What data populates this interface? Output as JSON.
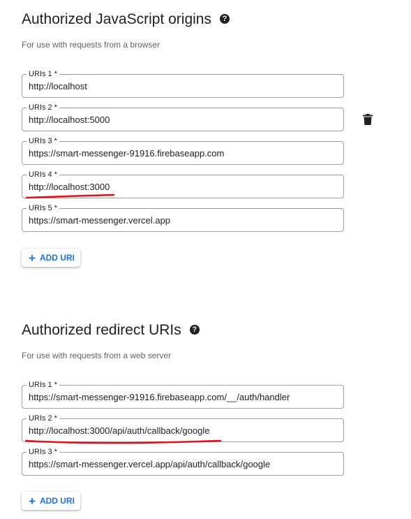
{
  "origins": {
    "title": "Authorized JavaScript origins",
    "help_icon": "help-circle-icon",
    "description": "For use with requests from a browser",
    "uris": [
      {
        "label": "URIs 1 *",
        "value": "http://localhost"
      },
      {
        "label": "URIs 2 *",
        "value": "http://localhost:5000"
      },
      {
        "label": "URIs 3 *",
        "value": "https://smart-messenger-91916.firebaseapp.com"
      },
      {
        "label": "URIs 4 *",
        "value": "http://localhost:3000"
      },
      {
        "label": "URIs 5 *",
        "value": "https://smart-messenger.vercel.app"
      }
    ],
    "delete_icon": "trash-icon",
    "add_button_label": "ADD URI"
  },
  "redirects": {
    "title": "Authorized redirect URIs",
    "help_icon": "help-circle-icon",
    "description": "For use with requests from a web server",
    "uris": [
      {
        "label": "URIs 1 *",
        "value": "https://smart-messenger-91916.firebaseapp.com/__/auth/handler"
      },
      {
        "label": "URIs 2 *",
        "value": "http://localhost:3000/api/auth/callback/google"
      },
      {
        "label": "URIs 3 *",
        "value": "https://smart-messenger.vercel.app/api/auth/callback/google"
      }
    ],
    "add_button_label": "ADD URI"
  },
  "colors": {
    "accent": "#1a73e8",
    "annotation": "#e0101a",
    "field_border": "#9aa0a6",
    "text": "#202124",
    "muted_text": "#5f6368"
  }
}
